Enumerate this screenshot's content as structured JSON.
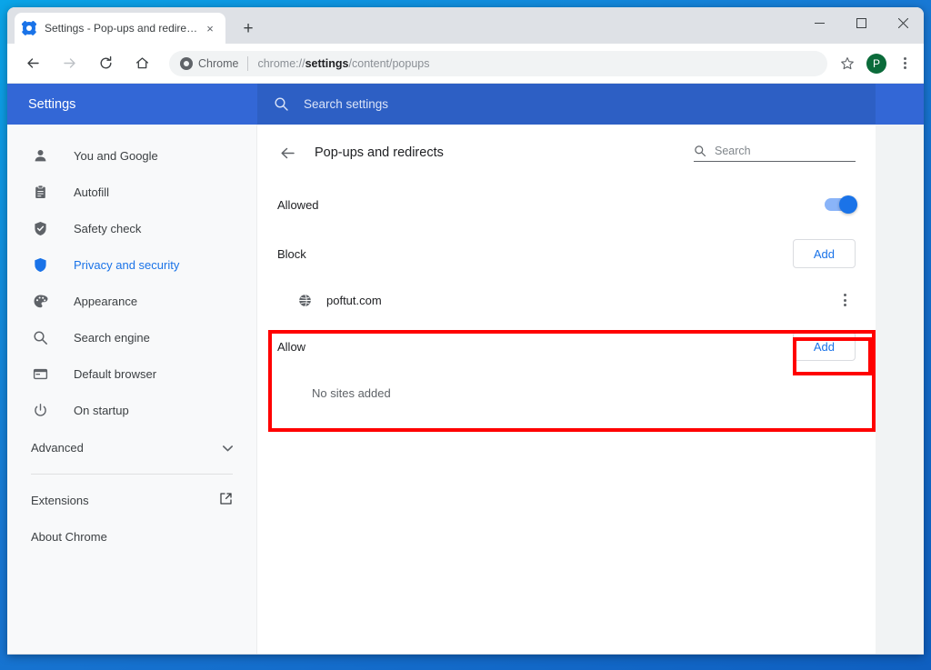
{
  "browser": {
    "tab": {
      "title": "Settings - Pop-ups and redirects",
      "favicon": "gear-icon",
      "close_label": "×"
    },
    "new_tab_label": "+",
    "window_controls": {
      "minimize": "minimize-icon",
      "maximize": "maximize-icon",
      "close": "close-icon"
    },
    "toolbar": {
      "back": "back-arrow-icon",
      "forward": "forward-arrow-icon",
      "reload": "reload-icon",
      "home": "home-icon",
      "omnibox": {
        "chip_label": "Chrome",
        "url_prefix": "chrome://",
        "url_bold": "settings",
        "url_suffix": "/content/popups"
      },
      "bookmark": "star-icon",
      "profile_initial": "P",
      "menu": "three-dot-menu-icon"
    }
  },
  "settings": {
    "header": {
      "title": "Settings",
      "search_placeholder": "Search settings",
      "search_icon": "search-icon"
    },
    "sidebar": {
      "items": [
        {
          "label": "You and Google",
          "icon": "person-icon"
        },
        {
          "label": "Autofill",
          "icon": "clipboard-icon"
        },
        {
          "label": "Safety check",
          "icon": "shield-check-icon"
        },
        {
          "label": "Privacy and security",
          "icon": "shield-icon",
          "active": true
        },
        {
          "label": "Appearance",
          "icon": "palette-icon"
        },
        {
          "label": "Search engine",
          "icon": "search-icon"
        },
        {
          "label": "Default browser",
          "icon": "browser-window-icon"
        },
        {
          "label": "On startup",
          "icon": "power-icon"
        }
      ],
      "advanced": {
        "label": "Advanced",
        "icon": "chevron-down-icon"
      },
      "links": [
        {
          "label": "Extensions",
          "icon": "external-link-icon"
        },
        {
          "label": "About Chrome",
          "icon": ""
        }
      ]
    },
    "content": {
      "back_icon": "back-arrow-icon",
      "title": "Pop-ups and redirects",
      "search": {
        "placeholder": "Search",
        "icon": "search-icon"
      },
      "allowed_setting": {
        "label": "Allowed",
        "enabled": true
      },
      "block_section": {
        "title": "Block",
        "add_label": "Add",
        "sites": [
          {
            "name": "poftut.com",
            "favicon": "globe-icon",
            "menu": "three-dot-menu-icon"
          }
        ]
      },
      "allow_section": {
        "title": "Allow",
        "add_label": "Add",
        "empty_text": "No sites added",
        "sites": []
      }
    }
  },
  "annotations": {
    "color": "#ff0000",
    "highlights": [
      "block-section",
      "block-add-button"
    ]
  }
}
